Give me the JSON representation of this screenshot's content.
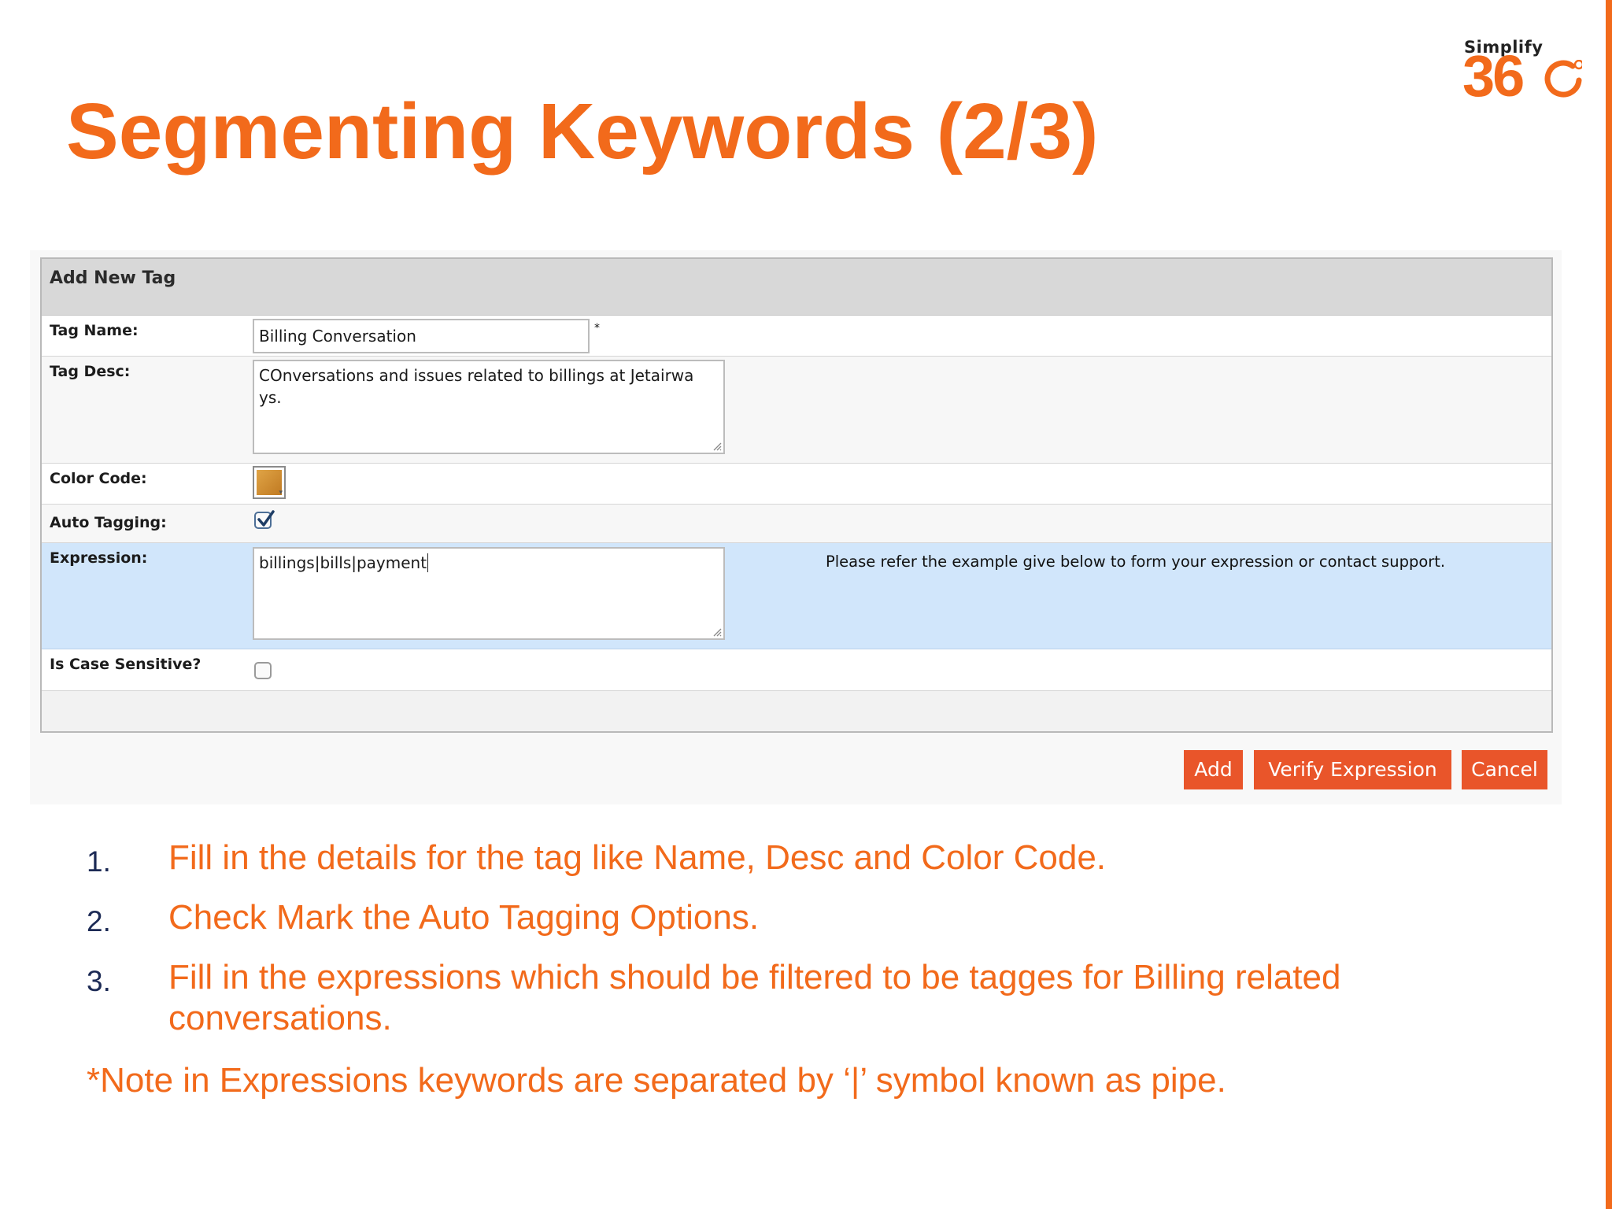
{
  "slide": {
    "title": "Segmenting Keywords (2/3)",
    "brand_color": "#f26a1b"
  },
  "logo": {
    "small_text": "Simplify",
    "big_text": "36"
  },
  "form": {
    "header": "Add New Tag",
    "tag_name": {
      "label": "Tag Name:",
      "value": "Billing Conversation",
      "required_mark": "*"
    },
    "tag_desc": {
      "label": "Tag Desc:",
      "value": "COnversations and issues related to billings at Jetairwa ys."
    },
    "color_code": {
      "label": "Color Code:",
      "swatch_color": "#d08a33"
    },
    "auto_tagging": {
      "label": "Auto Tagging:",
      "checked": true
    },
    "expression": {
      "label": "Expression:",
      "value": "billings|bills|payment",
      "hint": "Please refer the example give below to form your expression or contact support."
    },
    "case_sensitive": {
      "label": "Is Case Sensitive?",
      "checked": false
    }
  },
  "buttons": {
    "add": "Add",
    "verify": "Verify Expression",
    "cancel": "Cancel",
    "color": "#e9552a"
  },
  "steps": [
    {
      "number": "1.",
      "text": "Fill in the details for the tag like Name, Desc and Color Code."
    },
    {
      "number": "2.",
      "text": "Check Mark the Auto Tagging Options."
    },
    {
      "number": "3.",
      "text": "Fill in the expressions which should be filtered to be tagges for Billing related conversations."
    }
  ],
  "note": "*Note in Expressions keywords are separated by ‘|’ symbol known as pipe."
}
